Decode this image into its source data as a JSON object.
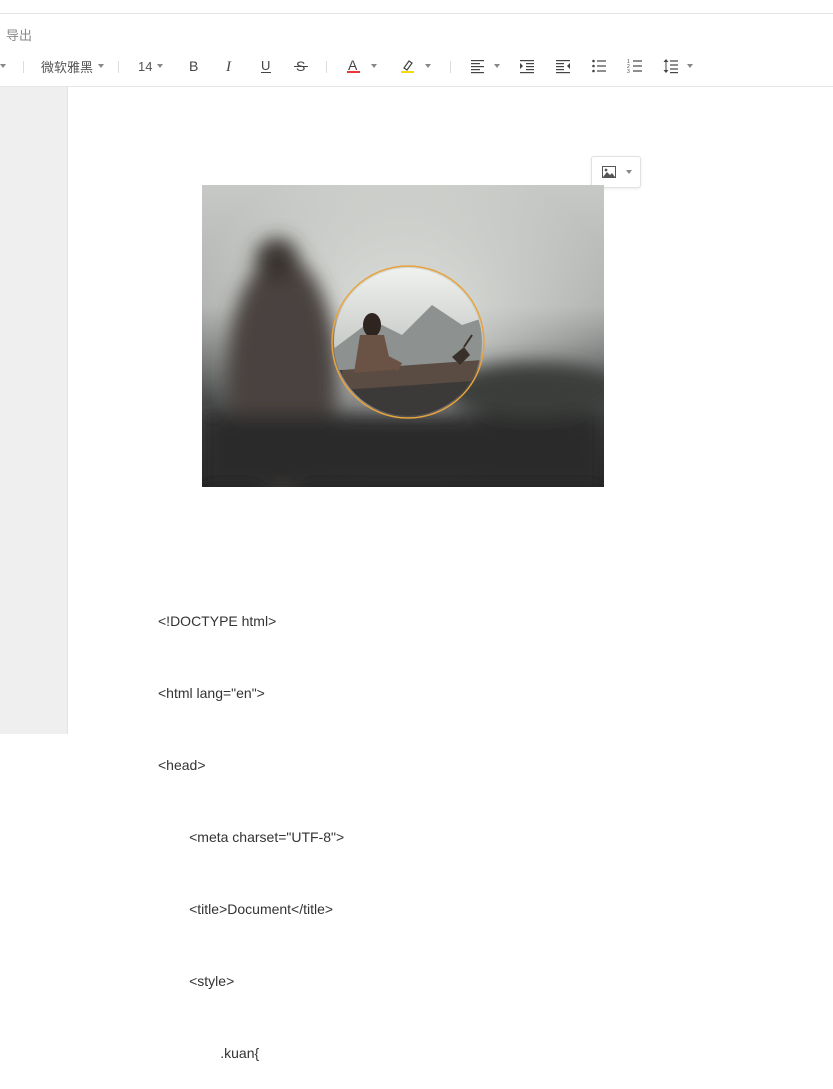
{
  "menu": {
    "export_label": "导出"
  },
  "toolbar": {
    "font_family": "微软雅黑",
    "font_size": "14",
    "icons": [
      "bold-icon",
      "italic-icon",
      "underline-icon",
      "strikethrough-icon",
      "font-color-icon",
      "highlight-icon",
      "align-left-icon",
      "indent-increase-icon",
      "indent-decrease-icon",
      "bullet-list-icon",
      "numbered-list-icon",
      "line-height-icon"
    ],
    "font_color": "#e53935",
    "highlight_color": "#f5d90a"
  },
  "image": {
    "ring_color": "#e8a33c"
  },
  "code_lines": [
    "<!DOCTYPE html>",
    "<html lang=\"en\">",
    "<head>",
    "        <meta charset=\"UTF-8\">",
    "        <title>Document</title>",
    "        <style>",
    "                .kuan{"
  ]
}
